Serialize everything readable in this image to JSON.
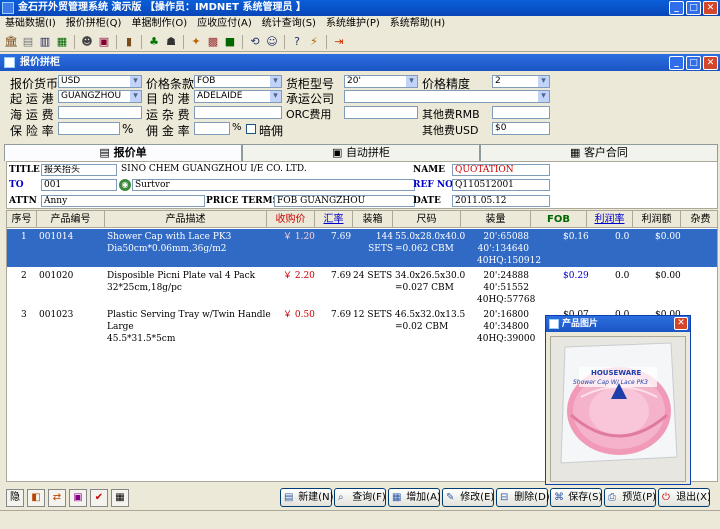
{
  "app": {
    "title": "金石开外贸管理系统 演示版  【操作员：IMDNET  系统管理员 】",
    "menu": [
      "基础数据(I)",
      "报价拼柜(Q)",
      "单据制作(O)",
      "应收应付(A)",
      "统计查询(S)",
      "系统维护(P)",
      "系统帮助(H)"
    ]
  },
  "window": {
    "title": "报价拼柜"
  },
  "form": {
    "currency_label": "报价货币",
    "currency": "USD",
    "price_terms_label": "价格条款",
    "price_terms": "FOB",
    "container_label": "货柜型号",
    "container": "20'",
    "precision_label": "价格精度",
    "precision": "2",
    "port_from_label": "起 运 港",
    "port_from": "GUANGZHOU",
    "port_to_label": "目 的 港",
    "port_to": "ADELAIDE",
    "carrier_label": "承运公司",
    "carrier": "",
    "sea_freight_label": "海 运 费",
    "sea_freight": "",
    "freight_label": "运 杂 费",
    "freight": "",
    "orc_label": "ORC费用",
    "orc": "",
    "other_rmb_label": "其他费RMB",
    "other_rmb": "",
    "insurance_label": "保 险 率",
    "insurance": "",
    "insurance_unit": "%",
    "commission_label": "佣 金 率",
    "commission": "",
    "commission_unit": "%",
    "hidden_label": "暗佣",
    "other_usd_label": "其他费USD",
    "other_usd": "$0"
  },
  "tabs": [
    "报价单",
    "自动拼柜",
    "客户合同"
  ],
  "header": {
    "title_label": "TITLE",
    "title_value": "报关抬头",
    "company": "SINO CHEM GUANGZHOU I/E CO. LTD.",
    "to_label": "TO",
    "to_code": "001",
    "to_name": "Surtvor",
    "attn_label": "ATTN",
    "attn": "Anny",
    "price_terms_label": "PRICE TERMS",
    "price_terms": "FOB GUANGZHOU",
    "name_label": "NAME",
    "name": "QUOTATION",
    "ref_label": "REF NO.",
    "ref": "Q110512001",
    "date_label": "DATE",
    "date": "2011.05.12"
  },
  "table": {
    "columns": [
      "序号",
      "产品编号",
      "产品描述",
      "收购价",
      "汇率",
      "装箱",
      "尺码",
      "装量",
      "FOB",
      "利润率",
      "利润额",
      "杂费"
    ],
    "rows": [
      {
        "no": "1",
        "code": "001014",
        "desc": "Shower Cap with Lace PK3\nDia50cm*0.06mm,36g/m2",
        "price": "￥ 1.20",
        "rate": "7.69",
        "pack": "144\nSETS",
        "size": "55.0x28.0x40.0\n=0.062 CBM",
        "load": "20':65088\n40':134640\n40HQ:150912",
        "fob": "$0.16",
        "margin": "0.0",
        "profit": "$0.00"
      },
      {
        "no": "2",
        "code": "001020",
        "desc": "Disposible Picni  Plate val 4 Pack\n32*25cm,18g/pc",
        "price": "￥ 2.20",
        "rate": "7.69",
        "pack": "24 SETS",
        "size": "34.0x26.5x30.0\n=0.027 CBM",
        "load": "20':24888\n40':51552\n40HQ:57768",
        "fob": "$0.29",
        "margin": "0.0",
        "profit": "$0.00"
      },
      {
        "no": "3",
        "code": "001023",
        "desc": "Plastic Serving Tray w/Twin Handle\nLarge\n45.5*31.5*5cm",
        "price": "￥ 0.50",
        "rate": "7.69",
        "pack": "12 SETS",
        "size": "46.5x32.0x13.5\n=0.02 CBM",
        "load": "20':16800\n40':34800\n40HQ:39000",
        "fob": "$0.07",
        "margin": "0.0",
        "profit": "$0.00"
      }
    ]
  },
  "popup": {
    "title": "产品图片",
    "brand": "HOUSEWARE",
    "product_text": "Shower Cap W/ Lace PK3"
  },
  "buttons": [
    "新建(N)",
    "查询(F)",
    "增加(A)",
    "修改(E)",
    "删除(D)",
    "保存(S)",
    "预览(P)",
    "退出(X)"
  ],
  "colors": {
    "selected_row": "#316ac5",
    "price_red": "#cc0000",
    "fob_header": "#006600"
  }
}
